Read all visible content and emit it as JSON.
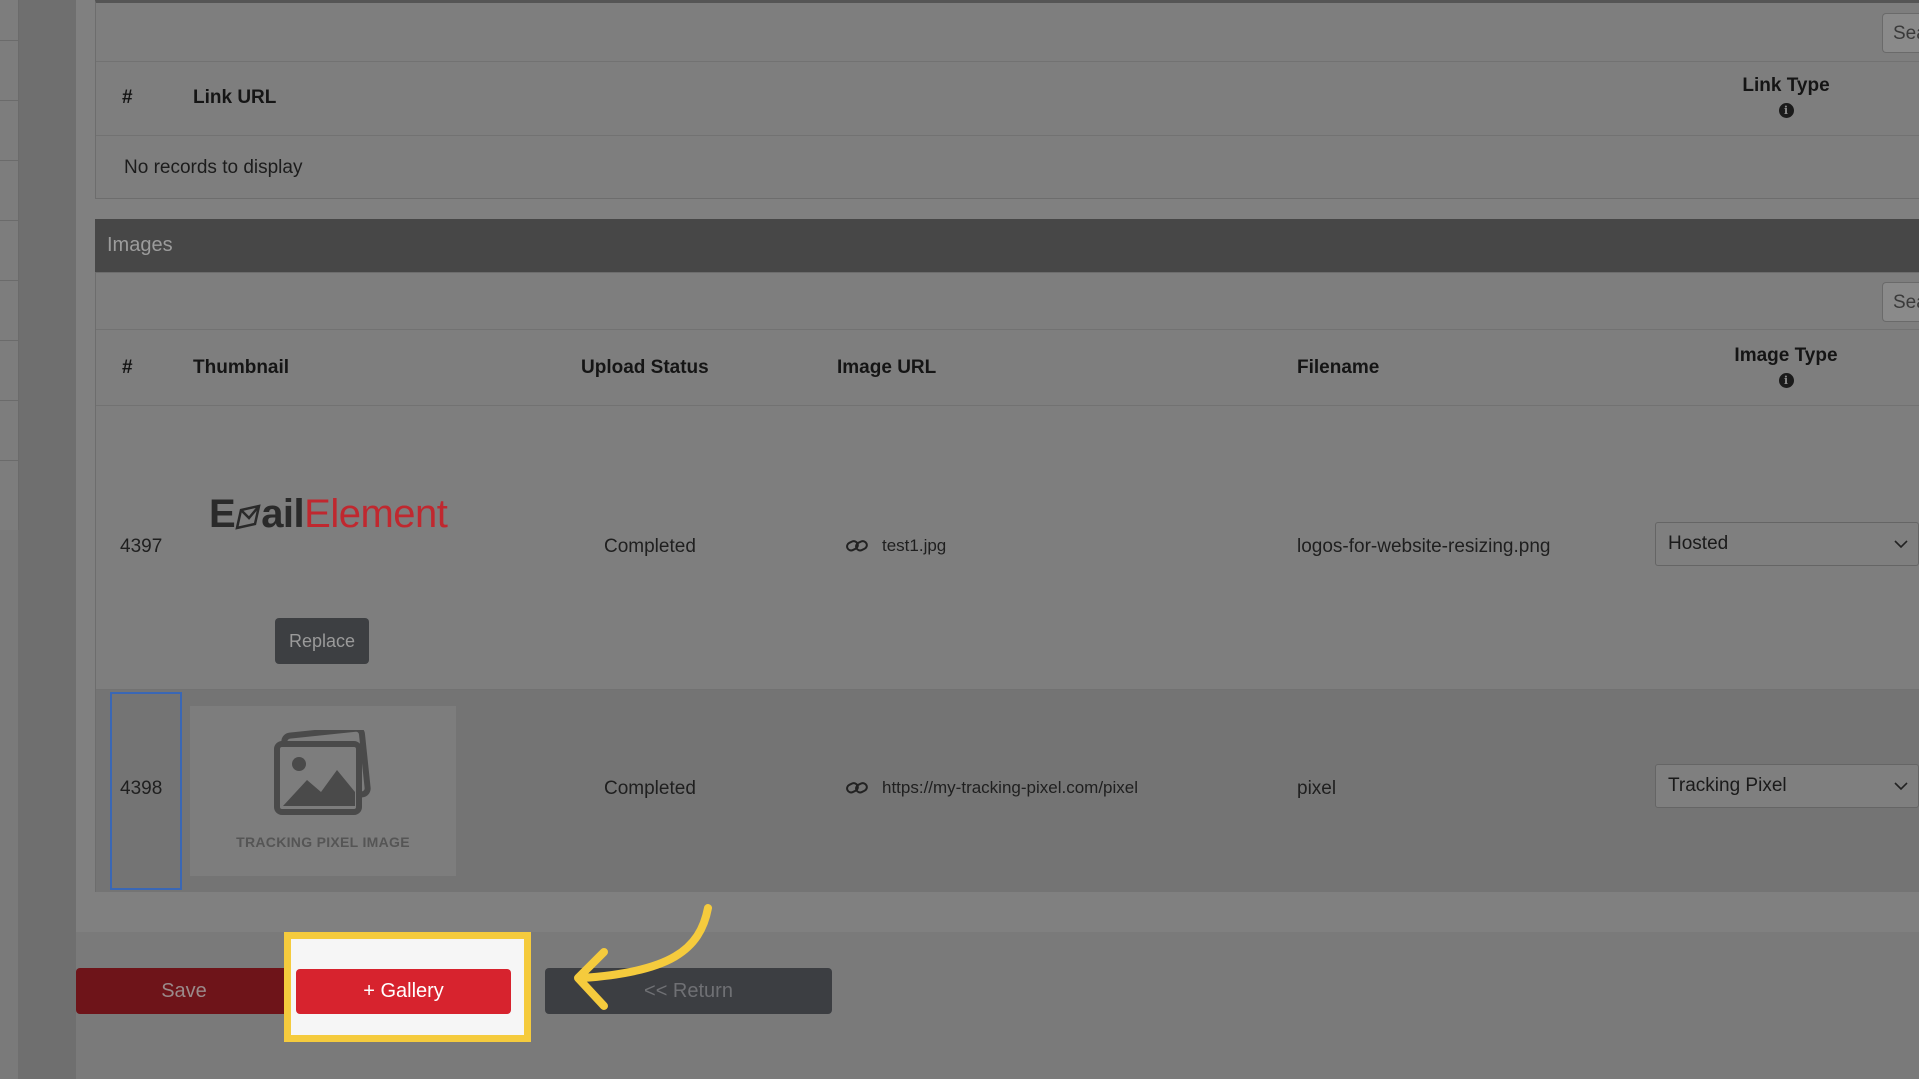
{
  "links_table": {
    "search_placeholder": "Search",
    "col_num": "#",
    "col_link_url": "Link URL",
    "col_link_type": "Link Type",
    "info_glyph": "i",
    "empty_message": "No records to display"
  },
  "images_section": {
    "title": "Images",
    "search_placeholder": "Search",
    "columns": {
      "num": "#",
      "thumbnail": "Thumbnail",
      "upload_status": "Upload Status",
      "image_url": "Image URL",
      "filename": "Filename",
      "image_type": "Image Type"
    },
    "info_glyph": "i",
    "rows": [
      {
        "id": "4397",
        "logo_text_a": "E",
        "logo_text_b": "ail",
        "logo_text_c": "Element",
        "replace_label": "Replace",
        "status": "Completed",
        "url": "test1.jpg",
        "filename": "logos-for-website-resizing.png",
        "image_type": "Hosted"
      },
      {
        "id": "4398",
        "thumb_caption": "TRACKING PIXEL IMAGE",
        "status": "Completed",
        "url": "https://my-tracking-pixel.com/pixel",
        "filename": "pixel",
        "image_type": "Tracking Pixel"
      }
    ]
  },
  "footer": {
    "save_label": "Save",
    "gallery_label": "+ Gallery",
    "return_label": "<< Return"
  },
  "colors": {
    "gallery_red": "#d7232e",
    "highlight_yellow": "#f5cb3d",
    "logo_red": "#c0282f"
  },
  "icons": [
    "info-icon",
    "link-icon",
    "chevron-down-icon",
    "image-placeholder-icon",
    "curved-arrow-icon"
  ]
}
